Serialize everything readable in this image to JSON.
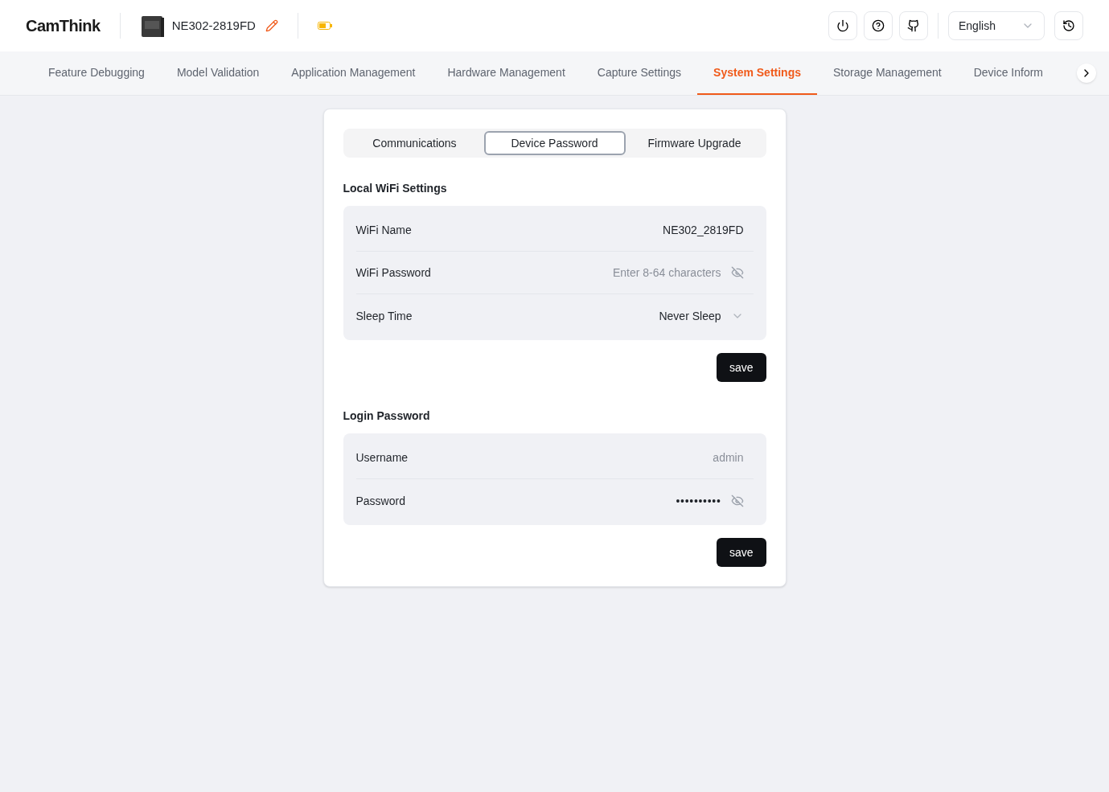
{
  "header": {
    "logo": "CamThink",
    "device_name": "NE302-2819FD",
    "language": "English"
  },
  "nav_tabs": [
    {
      "label": "Feature Debugging",
      "selected": false
    },
    {
      "label": "Model Validation",
      "selected": false
    },
    {
      "label": "Application Management",
      "selected": false
    },
    {
      "label": "Hardware Management",
      "selected": false
    },
    {
      "label": "Capture Settings",
      "selected": false
    },
    {
      "label": "System Settings",
      "selected": true
    },
    {
      "label": "Storage Management",
      "selected": false
    },
    {
      "label": "Device Inform",
      "selected": false
    }
  ],
  "sub_tabs": [
    {
      "label": "Communications",
      "selected": false
    },
    {
      "label": "Device Password",
      "selected": true
    },
    {
      "label": "Firmware Upgrade",
      "selected": false
    }
  ],
  "sections": [
    {
      "title": "Local WiFi Settings",
      "rows": [
        {
          "kind": "text",
          "label": "WiFi Name",
          "value": "NE302_2819FD"
        },
        {
          "kind": "password",
          "label": "WiFi Password",
          "placeholder": "Enter 8-64 characters"
        },
        {
          "kind": "select",
          "label": "Sleep Time",
          "value": "Never Sleep"
        }
      ],
      "button": "save"
    },
    {
      "title": "Login Password",
      "rows": [
        {
          "kind": "text",
          "label": "Username",
          "value": "admin",
          "disabled": true
        },
        {
          "kind": "password",
          "label": "Password",
          "value": "••••••••••"
        }
      ],
      "button": "save"
    }
  ]
}
